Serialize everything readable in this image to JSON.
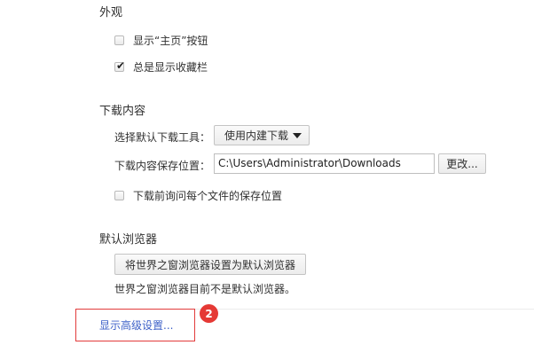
{
  "appearance": {
    "heading": "外观",
    "show_home": {
      "label": "显示“主页”按钮",
      "checked": false
    },
    "show_bookmarks": {
      "label": "总是显示收藏栏",
      "checked": true
    }
  },
  "downloads": {
    "heading": "下载内容",
    "tool_label": "选择默认下载工具：",
    "tool_value": "使用内建下载",
    "location_label": "下载内容保存位置：",
    "location_value": "C:\\Users\\Administrator\\Downloads",
    "change_button": "更改...",
    "ask_before": {
      "label": "下载前询问每个文件的保存位置",
      "checked": false
    }
  },
  "default_browser": {
    "heading": "默认浏览器",
    "set_default_button": "将世界之窗浏览器设置为默认浏览器",
    "status": "世界之窗浏览器目前不是默认浏览器。"
  },
  "footer": {
    "advanced_link": "显示高级设置..."
  },
  "annotation": {
    "badge": "2",
    "color": "#e53935"
  },
  "colors": {
    "link": "#3f62c8",
    "highlight": "#e23b3b"
  }
}
